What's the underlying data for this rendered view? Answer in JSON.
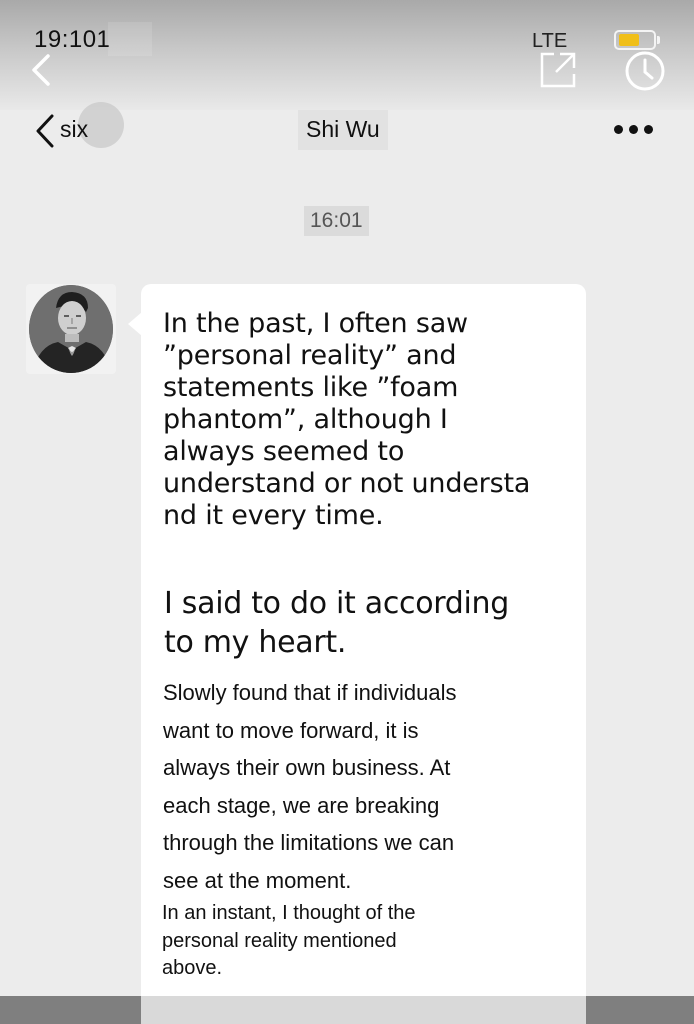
{
  "status_bar": {
    "time": "19:101",
    "network": "LTE",
    "battery_color": "#f0bf19"
  },
  "overlay_controls": {
    "back_icon": "chevron-left-icon",
    "share_icon": "share-icon",
    "clock_icon": "clock-icon"
  },
  "nav": {
    "back_label": "six",
    "title": "Shi Wu",
    "more_icon": "more-dots-icon"
  },
  "chat": {
    "timestamp": "16:01",
    "message": {
      "paragraph1": "In the past, I often saw\n”personal reality” and\nstatements like ”foam\nphantom”, although I\nalways seemed to\nunderstand or not understa\nnd it every time.",
      "paragraph2": "I said to do it according\nto my heart.",
      "paragraph3": "Slowly found that if individuals\n want to move forward, it is\nalways their own business. At\neach stage, we are breaking\nthrough the limitations we can\nsee at the moment.",
      "paragraph4": "In an instant, I thought of the\npersonal reality mentioned\nabove."
    }
  }
}
